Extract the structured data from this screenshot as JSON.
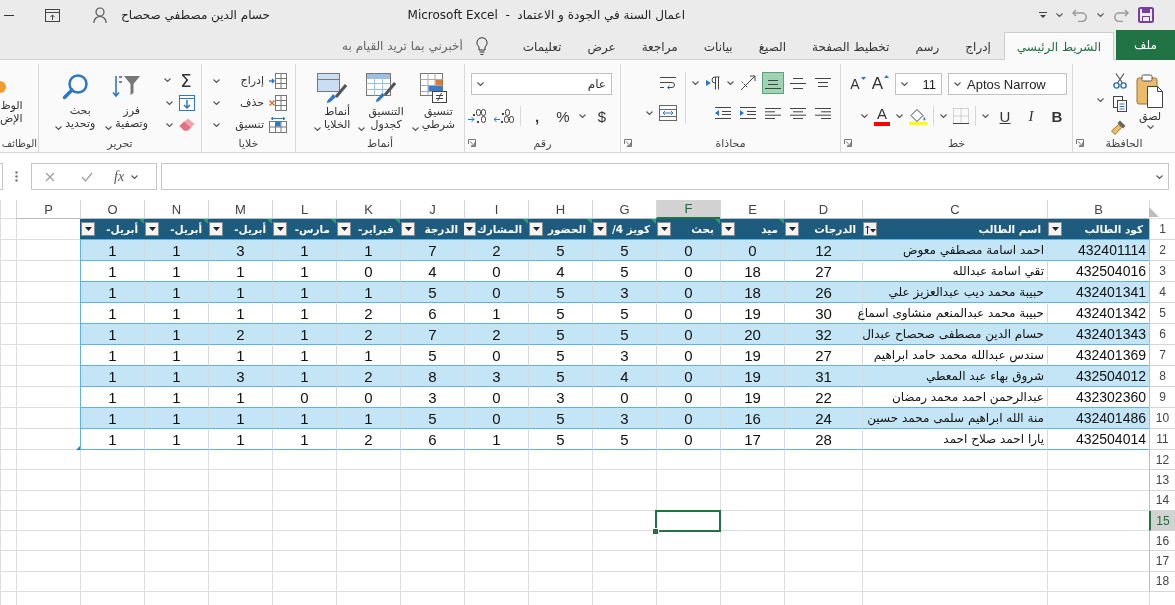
{
  "title_bar": {
    "user_name": "حسام الدين مصطفي صحصاح",
    "title": "اعمال السنة في الجودة و الاعتماد  -  Microsoft Excel"
  },
  "tabs": [
    {
      "label": "ملف",
      "kind": "file",
      "selected": false
    },
    {
      "label": "الشريط الرئيسي",
      "kind": "tab",
      "selected": true
    },
    {
      "label": "إدراج",
      "kind": "tab",
      "selected": false
    },
    {
      "label": "رسم",
      "kind": "tab",
      "selected": false
    },
    {
      "label": "تخطيط الصفحة",
      "kind": "tab",
      "selected": false
    },
    {
      "label": "الصيغ",
      "kind": "tab",
      "selected": false
    },
    {
      "label": "بيانات",
      "kind": "tab",
      "selected": false
    },
    {
      "label": "مراجعة",
      "kind": "tab",
      "selected": false
    },
    {
      "label": "عرض",
      "kind": "tab",
      "selected": false
    },
    {
      "label": "تعليمات",
      "kind": "tab",
      "selected": false
    }
  ],
  "tell_me": {
    "placeholder": "أخبرني بما تريد القيام به"
  },
  "ribbon": {
    "clipboard": {
      "label": "الحافظة",
      "paste": "لصق"
    },
    "font": {
      "label": "خط",
      "name": "Aptos Narrow",
      "size": "11",
      "grow_font": "A",
      "shrink_font": "A",
      "bold": "B",
      "italic": "I",
      "underline": "U",
      "font_color": "A"
    },
    "alignment": {
      "label": "محاذاة",
      "buttons": [
        {
          "kind": "top",
          "selected": false
        },
        {
          "kind": "middle",
          "selected": false
        },
        {
          "kind": "bottom",
          "selected": true
        },
        {
          "kind": "right",
          "selected": false
        },
        {
          "kind": "center",
          "selected": false
        },
        {
          "kind": "left",
          "selected": false
        }
      ]
    },
    "number": {
      "label": "رقم",
      "format": "عام",
      "currency": "$",
      "percent": "%",
      "comma": ","
    },
    "styles": {
      "label": "أنماط",
      "buttons": [
        {
          "kind": "conditional",
          "label": "تنسيق شرطي"
        },
        {
          "kind": "table",
          "label": "التنسيق كجدول"
        },
        {
          "kind": "cell-styles",
          "label": "أنماط الخلايا"
        }
      ]
    },
    "cells": {
      "label": "خلايا",
      "buttons": [
        {
          "kind": "insert",
          "label": "إدراج"
        },
        {
          "kind": "delete",
          "label": "حذف"
        },
        {
          "kind": "format",
          "label": "تنسيق"
        }
      ]
    },
    "editing": {
      "label": "تحرير",
      "sum": "Σ",
      "sort_filter": "فرز وتصفية",
      "find_select": "بحث وتحديد"
    },
    "add_ins": {
      "label": "الوظائف",
      "button": "الوظ الإض"
    }
  },
  "formula_bar": {
    "function": "fx"
  },
  "sheet": {
    "column_headers": [
      {
        "label": "B",
        "selected": false
      },
      {
        "label": "C",
        "selected": false
      },
      {
        "label": "D",
        "selected": false
      },
      {
        "label": "E",
        "selected": false
      },
      {
        "label": "F",
        "selected": true
      },
      {
        "label": "G",
        "selected": false
      },
      {
        "label": "H",
        "selected": false
      },
      {
        "label": "I",
        "selected": false
      },
      {
        "label": "J",
        "selected": false
      },
      {
        "label": "K",
        "selected": false
      },
      {
        "label": "L",
        "selected": false
      },
      {
        "label": "M",
        "selected": false
      },
      {
        "label": "N",
        "selected": false
      },
      {
        "label": "O",
        "selected": false
      },
      {
        "label": "P",
        "selected": false
      }
    ],
    "row_headers": [
      {
        "label": "1",
        "selected": false
      },
      {
        "label": "2",
        "selected": false
      },
      {
        "label": "3",
        "selected": false
      },
      {
        "label": "4",
        "selected": false
      },
      {
        "label": "5",
        "selected": false
      },
      {
        "label": "6",
        "selected": false
      },
      {
        "label": "7",
        "selected": false
      },
      {
        "label": "8",
        "selected": false
      },
      {
        "label": "9",
        "selected": false
      },
      {
        "label": "10",
        "selected": false
      },
      {
        "label": "11",
        "selected": false
      },
      {
        "label": "12",
        "selected": false
      },
      {
        "label": "13",
        "selected": false
      },
      {
        "label": "14",
        "selected": false
      },
      {
        "label": "15",
        "selected": true
      },
      {
        "label": "16",
        "selected": false
      },
      {
        "label": "17",
        "selected": false
      },
      {
        "label": "18",
        "selected": false
      }
    ]
  },
  "table": {
    "columns": [
      {
        "header": "كود الطالب",
        "sorted": false,
        "flagged": false
      },
      {
        "header": "اسم الطالب",
        "sorted": true,
        "flagged": false
      },
      {
        "header": "الدرجات",
        "sorted": false,
        "flagged": false
      },
      {
        "header": "ميد",
        "sorted": false,
        "flagged": true
      },
      {
        "header": "بحث",
        "sorted": false,
        "flagged": true
      },
      {
        "header": "كويز 4/",
        "sorted": false,
        "flagged": true
      },
      {
        "header": "الحضور",
        "sorted": false,
        "flagged": true
      },
      {
        "header": "المشارك",
        "sorted": false,
        "flagged": true
      },
      {
        "header": "الدرجة",
        "sorted": false,
        "flagged": false
      },
      {
        "header": "فبراير-",
        "sorted": false,
        "flagged": true
      },
      {
        "header": "مارس-",
        "sorted": false,
        "flagged": true
      },
      {
        "header": "أبريل-",
        "sorted": false,
        "flagged": true
      },
      {
        "header": "أبريل-",
        "sorted": false,
        "flagged": true
      },
      {
        "header": "أبريل-",
        "sorted": false,
        "flagged": true
      }
    ],
    "rows": [
      [
        "432401114",
        "احمد اسامة مصطفي معوض",
        "12",
        "0",
        "0",
        "5",
        "5",
        "2",
        "7",
        "1",
        "1",
        "3",
        "1",
        "1"
      ],
      [
        "432504016",
        "تقي اسامة عبدالله",
        "27",
        "18",
        "0",
        "5",
        "4",
        "0",
        "4",
        "0",
        "1",
        "1",
        "1",
        "1"
      ],
      [
        "432401341",
        "حبيبة محمد ديب عبدالعزيز علي",
        "26",
        "18",
        "0",
        "3",
        "5",
        "0",
        "5",
        "1",
        "1",
        "1",
        "1",
        "1"
      ],
      [
        "432401342",
        "حبيبة محمد عبدالمنعم منشاوى اسماع",
        "30",
        "19",
        "0",
        "5",
        "5",
        "1",
        "6",
        "2",
        "1",
        "1",
        "1",
        "1"
      ],
      [
        "432401343",
        "حسام الدين مصطفى صحصاح عبدال",
        "32",
        "20",
        "0",
        "5",
        "5",
        "2",
        "7",
        "2",
        "1",
        "2",
        "1",
        "1"
      ],
      [
        "432401369",
        "سندس عبدالله محمد حامد ابراهيم",
        "27",
        "19",
        "0",
        "3",
        "5",
        "0",
        "5",
        "1",
        "1",
        "1",
        "1",
        "1"
      ],
      [
        "432504012",
        "شروق بهاء عبد المعطي",
        "31",
        "19",
        "0",
        "4",
        "5",
        "3",
        "8",
        "2",
        "1",
        "3",
        "1",
        "1"
      ],
      [
        "432302360",
        "عبدالرحمن احمد محمد رمضان",
        "22",
        "19",
        "0",
        "0",
        "3",
        "0",
        "3",
        "0",
        "0",
        "1",
        "1",
        "1"
      ],
      [
        "432401486",
        "منة الله ابراهيم سلمى محمد حسين",
        "24",
        "16",
        "0",
        "3",
        "5",
        "0",
        "5",
        "1",
        "1",
        "1",
        "1",
        "1"
      ],
      [
        "432504014",
        "يارا احمد صلاح احمد",
        "28",
        "17",
        "0",
        "5",
        "5",
        "1",
        "6",
        "2",
        "1",
        "1",
        "1",
        "1"
      ]
    ]
  }
}
